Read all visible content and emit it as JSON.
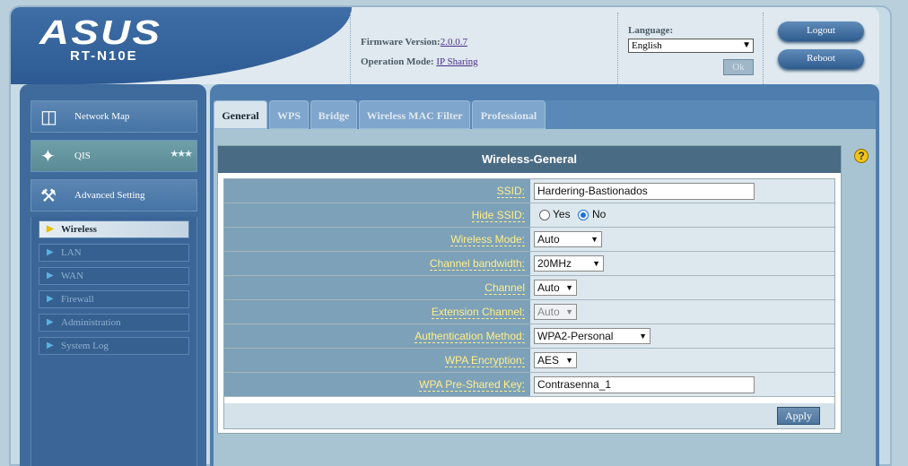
{
  "header": {
    "logo": "ASUS",
    "model": "RT-N10E",
    "firmware_label": "Firmware Version:",
    "firmware_value": "2.0.0.7",
    "opmode_label": "Operation Mode:",
    "opmode_value": "IP Sharing",
    "language_label": "Language:",
    "language_value": "English",
    "ok_label": "Ok",
    "logout_label": "Logout",
    "reboot_label": "Reboot"
  },
  "sidebar": {
    "network_map": "Network Map",
    "qis": "QIS",
    "advanced": "Advanced Setting",
    "items": [
      "Wireless",
      "LAN",
      "WAN",
      "Firewall",
      "Administration",
      "System Log"
    ]
  },
  "tabs": [
    "General",
    "WPS",
    "Bridge",
    "Wireless MAC Filter",
    "Professional"
  ],
  "panel": {
    "title": "Wireless-General",
    "ssid_label": "SSID:",
    "ssid_value": "Hardering-Bastionados",
    "hide_ssid_label": "Hide SSID:",
    "hide_yes": "Yes",
    "hide_no": "No",
    "mode_label": "Wireless Mode:",
    "mode_value": "Auto",
    "bandwidth_label": "Channel bandwidth:",
    "bandwidth_value": "20MHz",
    "channel_label": "Channel",
    "channel_value": "Auto",
    "ext_channel_label": "Extension Channel:",
    "ext_channel_value": "Auto",
    "auth_label": "Authentication Method:",
    "auth_value": "WPA2-Personal",
    "enc_label": "WPA Encryption:",
    "enc_value": "AES",
    "psk_label": "WPA Pre-Shared Key:",
    "psk_value": "Contrasenna_1",
    "apply_label": "Apply"
  }
}
